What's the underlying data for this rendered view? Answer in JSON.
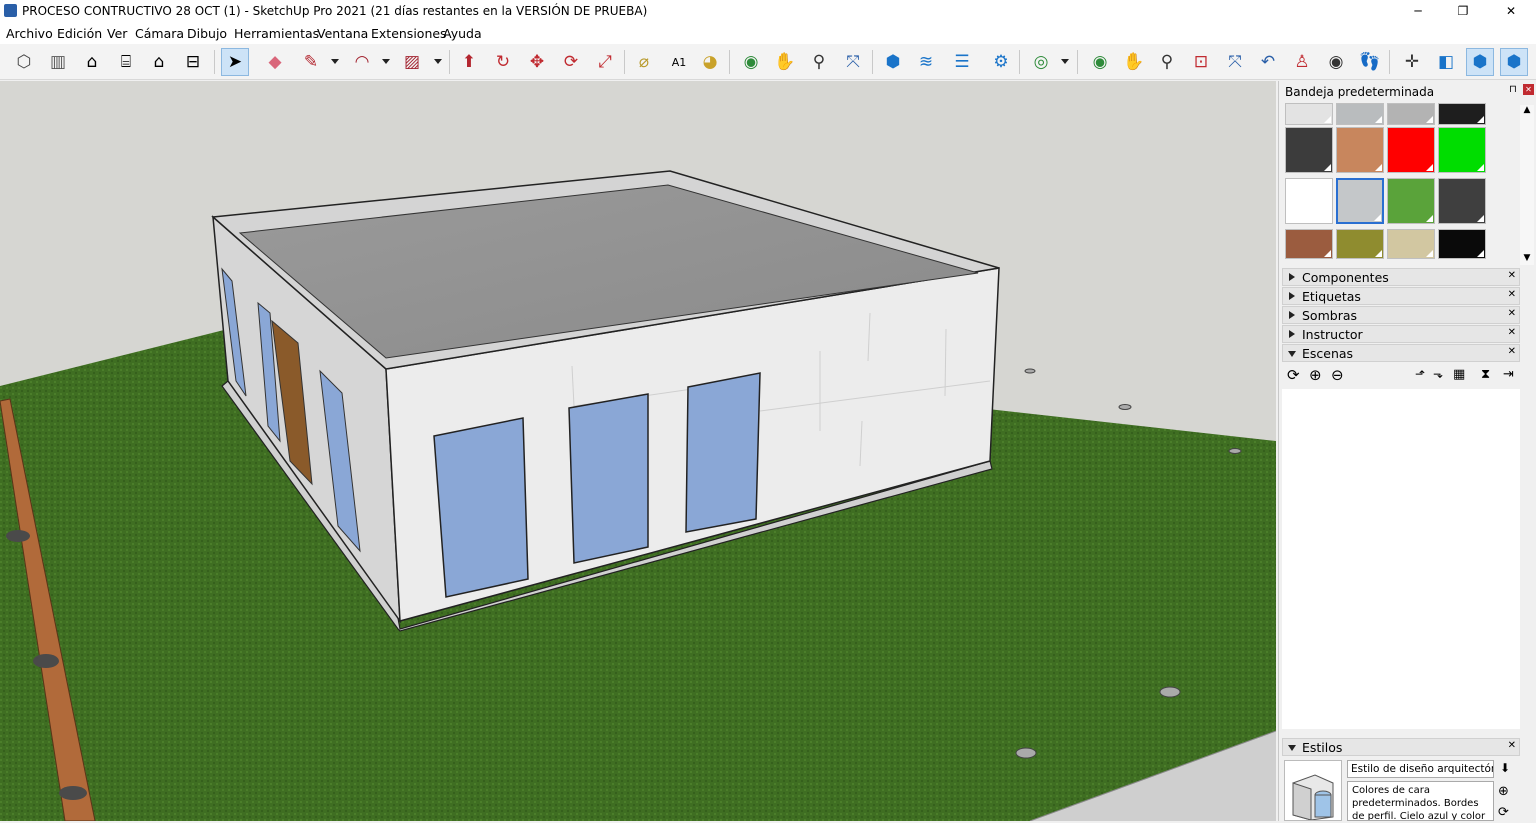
{
  "window": {
    "title": "PROCESO CONTRUCTIVO 28 OCT (1) - SketchUp Pro 2021 (21 días restantes en la VERSIÓN DE PRUEBA)",
    "minimize": "─",
    "restore": "❐",
    "close": "✕"
  },
  "menu": [
    "Archivo",
    "Edición",
    "Ver",
    "Cámara",
    "Dibujo",
    "Herramientas",
    "Ventana",
    "Extensiones",
    "Ayuda"
  ],
  "toolbar": {
    "icons": [
      "iso-view-icon",
      "top-view-icon",
      "front-view-icon",
      "right-view-icon",
      "back-view-icon",
      "left-view-icon",
      "select-icon",
      "eraser-icon",
      "pencil-icon",
      "arc-icon",
      "rectangle-icon",
      "push-pull-icon",
      "follow-me-icon",
      "move-icon",
      "rotate-icon",
      "scale-icon",
      "tape-measure-icon",
      "text-icon",
      "paint-bucket-icon",
      "orbit-icon",
      "pan-icon",
      "zoom-icon",
      "zoom-extents-icon",
      "3d-warehouse-icon",
      "extension-warehouse-icon",
      "layout-icon",
      "extension-manager-icon",
      "account-icon",
      "orbit-icon-2",
      "pan-icon-2",
      "zoom-icon-2",
      "zoom-window-icon",
      "zoom-extents-icon-2",
      "previous-view-icon",
      "position-camera-icon",
      "look-around-icon",
      "walk-icon",
      "axes-icon",
      "section-plane-icon",
      "display-section-planes-icon",
      "display-section-cuts-icon"
    ]
  },
  "tray": {
    "title": "Bandeja predeterminada",
    "pin": "⊓",
    "close": "✕",
    "materials": [
      "#e3e3e3",
      "#b9bcbe",
      "#b3b3b3",
      "#1e1e1e",
      "#3c3c3c",
      "#c8865d",
      "#ff0000",
      "#00dd00",
      "#ffffff",
      "#c4c7c9",
      "#5aa33a",
      "#3f3f3f",
      "#9b5c3f",
      "#8f8c2f",
      "#d2c7a1",
      "#0a0a0a"
    ],
    "panels": [
      {
        "label": "Componentes",
        "expanded": false
      },
      {
        "label": "Etiquetas",
        "expanded": false
      },
      {
        "label": "Sombras",
        "expanded": false
      },
      {
        "label": "Instructor",
        "expanded": false
      },
      {
        "label": "Escenas",
        "expanded": true
      }
    ],
    "scene_icons": [
      "refresh-icon",
      "add-scene-icon",
      "remove-scene-icon",
      "move-up-icon",
      "move-down-icon",
      "view-options-icon",
      "details-icon",
      "scene-menu-icon"
    ],
    "styles": {
      "label": "Estilos",
      "style_name": "Estilo de diseño arquitectónico",
      "description": "Colores de cara predeterminados. Bordes de perfil. Cielo azul y color de"
    }
  }
}
